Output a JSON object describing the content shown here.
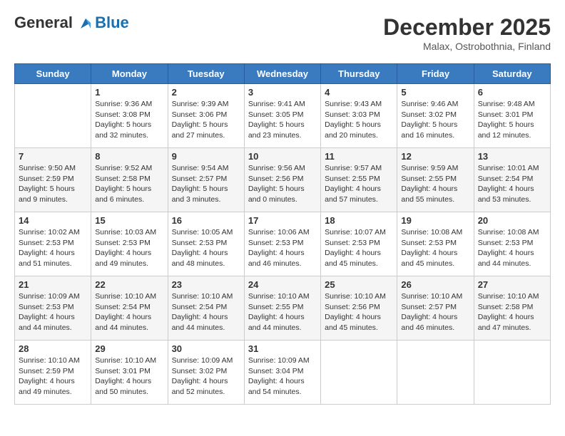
{
  "header": {
    "logo_line1": "General",
    "logo_line2": "Blue",
    "month": "December 2025",
    "location": "Malax, Ostrobothnia, Finland"
  },
  "days_of_week": [
    "Sunday",
    "Monday",
    "Tuesday",
    "Wednesday",
    "Thursday",
    "Friday",
    "Saturday"
  ],
  "weeks": [
    [
      {
        "day": "",
        "info": ""
      },
      {
        "day": "1",
        "info": "Sunrise: 9:36 AM\nSunset: 3:08 PM\nDaylight: 5 hours\nand 32 minutes."
      },
      {
        "day": "2",
        "info": "Sunrise: 9:39 AM\nSunset: 3:06 PM\nDaylight: 5 hours\nand 27 minutes."
      },
      {
        "day": "3",
        "info": "Sunrise: 9:41 AM\nSunset: 3:05 PM\nDaylight: 5 hours\nand 23 minutes."
      },
      {
        "day": "4",
        "info": "Sunrise: 9:43 AM\nSunset: 3:03 PM\nDaylight: 5 hours\nand 20 minutes."
      },
      {
        "day": "5",
        "info": "Sunrise: 9:46 AM\nSunset: 3:02 PM\nDaylight: 5 hours\nand 16 minutes."
      },
      {
        "day": "6",
        "info": "Sunrise: 9:48 AM\nSunset: 3:01 PM\nDaylight: 5 hours\nand 12 minutes."
      }
    ],
    [
      {
        "day": "7",
        "info": "Sunrise: 9:50 AM\nSunset: 2:59 PM\nDaylight: 5 hours\nand 9 minutes."
      },
      {
        "day": "8",
        "info": "Sunrise: 9:52 AM\nSunset: 2:58 PM\nDaylight: 5 hours\nand 6 minutes."
      },
      {
        "day": "9",
        "info": "Sunrise: 9:54 AM\nSunset: 2:57 PM\nDaylight: 5 hours\nand 3 minutes."
      },
      {
        "day": "10",
        "info": "Sunrise: 9:56 AM\nSunset: 2:56 PM\nDaylight: 5 hours\nand 0 minutes."
      },
      {
        "day": "11",
        "info": "Sunrise: 9:57 AM\nSunset: 2:55 PM\nDaylight: 4 hours\nand 57 minutes."
      },
      {
        "day": "12",
        "info": "Sunrise: 9:59 AM\nSunset: 2:55 PM\nDaylight: 4 hours\nand 55 minutes."
      },
      {
        "day": "13",
        "info": "Sunrise: 10:01 AM\nSunset: 2:54 PM\nDaylight: 4 hours\nand 53 minutes."
      }
    ],
    [
      {
        "day": "14",
        "info": "Sunrise: 10:02 AM\nSunset: 2:53 PM\nDaylight: 4 hours\nand 51 minutes."
      },
      {
        "day": "15",
        "info": "Sunrise: 10:03 AM\nSunset: 2:53 PM\nDaylight: 4 hours\nand 49 minutes."
      },
      {
        "day": "16",
        "info": "Sunrise: 10:05 AM\nSunset: 2:53 PM\nDaylight: 4 hours\nand 48 minutes."
      },
      {
        "day": "17",
        "info": "Sunrise: 10:06 AM\nSunset: 2:53 PM\nDaylight: 4 hours\nand 46 minutes."
      },
      {
        "day": "18",
        "info": "Sunrise: 10:07 AM\nSunset: 2:53 PM\nDaylight: 4 hours\nand 45 minutes."
      },
      {
        "day": "19",
        "info": "Sunrise: 10:08 AM\nSunset: 2:53 PM\nDaylight: 4 hours\nand 45 minutes."
      },
      {
        "day": "20",
        "info": "Sunrise: 10:08 AM\nSunset: 2:53 PM\nDaylight: 4 hours\nand 44 minutes."
      }
    ],
    [
      {
        "day": "21",
        "info": "Sunrise: 10:09 AM\nSunset: 2:53 PM\nDaylight: 4 hours\nand 44 minutes."
      },
      {
        "day": "22",
        "info": "Sunrise: 10:10 AM\nSunset: 2:54 PM\nDaylight: 4 hours\nand 44 minutes."
      },
      {
        "day": "23",
        "info": "Sunrise: 10:10 AM\nSunset: 2:54 PM\nDaylight: 4 hours\nand 44 minutes."
      },
      {
        "day": "24",
        "info": "Sunrise: 10:10 AM\nSunset: 2:55 PM\nDaylight: 4 hours\nand 44 minutes."
      },
      {
        "day": "25",
        "info": "Sunrise: 10:10 AM\nSunset: 2:56 PM\nDaylight: 4 hours\nand 45 minutes."
      },
      {
        "day": "26",
        "info": "Sunrise: 10:10 AM\nSunset: 2:57 PM\nDaylight: 4 hours\nand 46 minutes."
      },
      {
        "day": "27",
        "info": "Sunrise: 10:10 AM\nSunset: 2:58 PM\nDaylight: 4 hours\nand 47 minutes."
      }
    ],
    [
      {
        "day": "28",
        "info": "Sunrise: 10:10 AM\nSunset: 2:59 PM\nDaylight: 4 hours\nand 49 minutes."
      },
      {
        "day": "29",
        "info": "Sunrise: 10:10 AM\nSunset: 3:01 PM\nDaylight: 4 hours\nand 50 minutes."
      },
      {
        "day": "30",
        "info": "Sunrise: 10:09 AM\nSunset: 3:02 PM\nDaylight: 4 hours\nand 52 minutes."
      },
      {
        "day": "31",
        "info": "Sunrise: 10:09 AM\nSunset: 3:04 PM\nDaylight: 4 hours\nand 54 minutes."
      },
      {
        "day": "",
        "info": ""
      },
      {
        "day": "",
        "info": ""
      },
      {
        "day": "",
        "info": ""
      }
    ]
  ]
}
